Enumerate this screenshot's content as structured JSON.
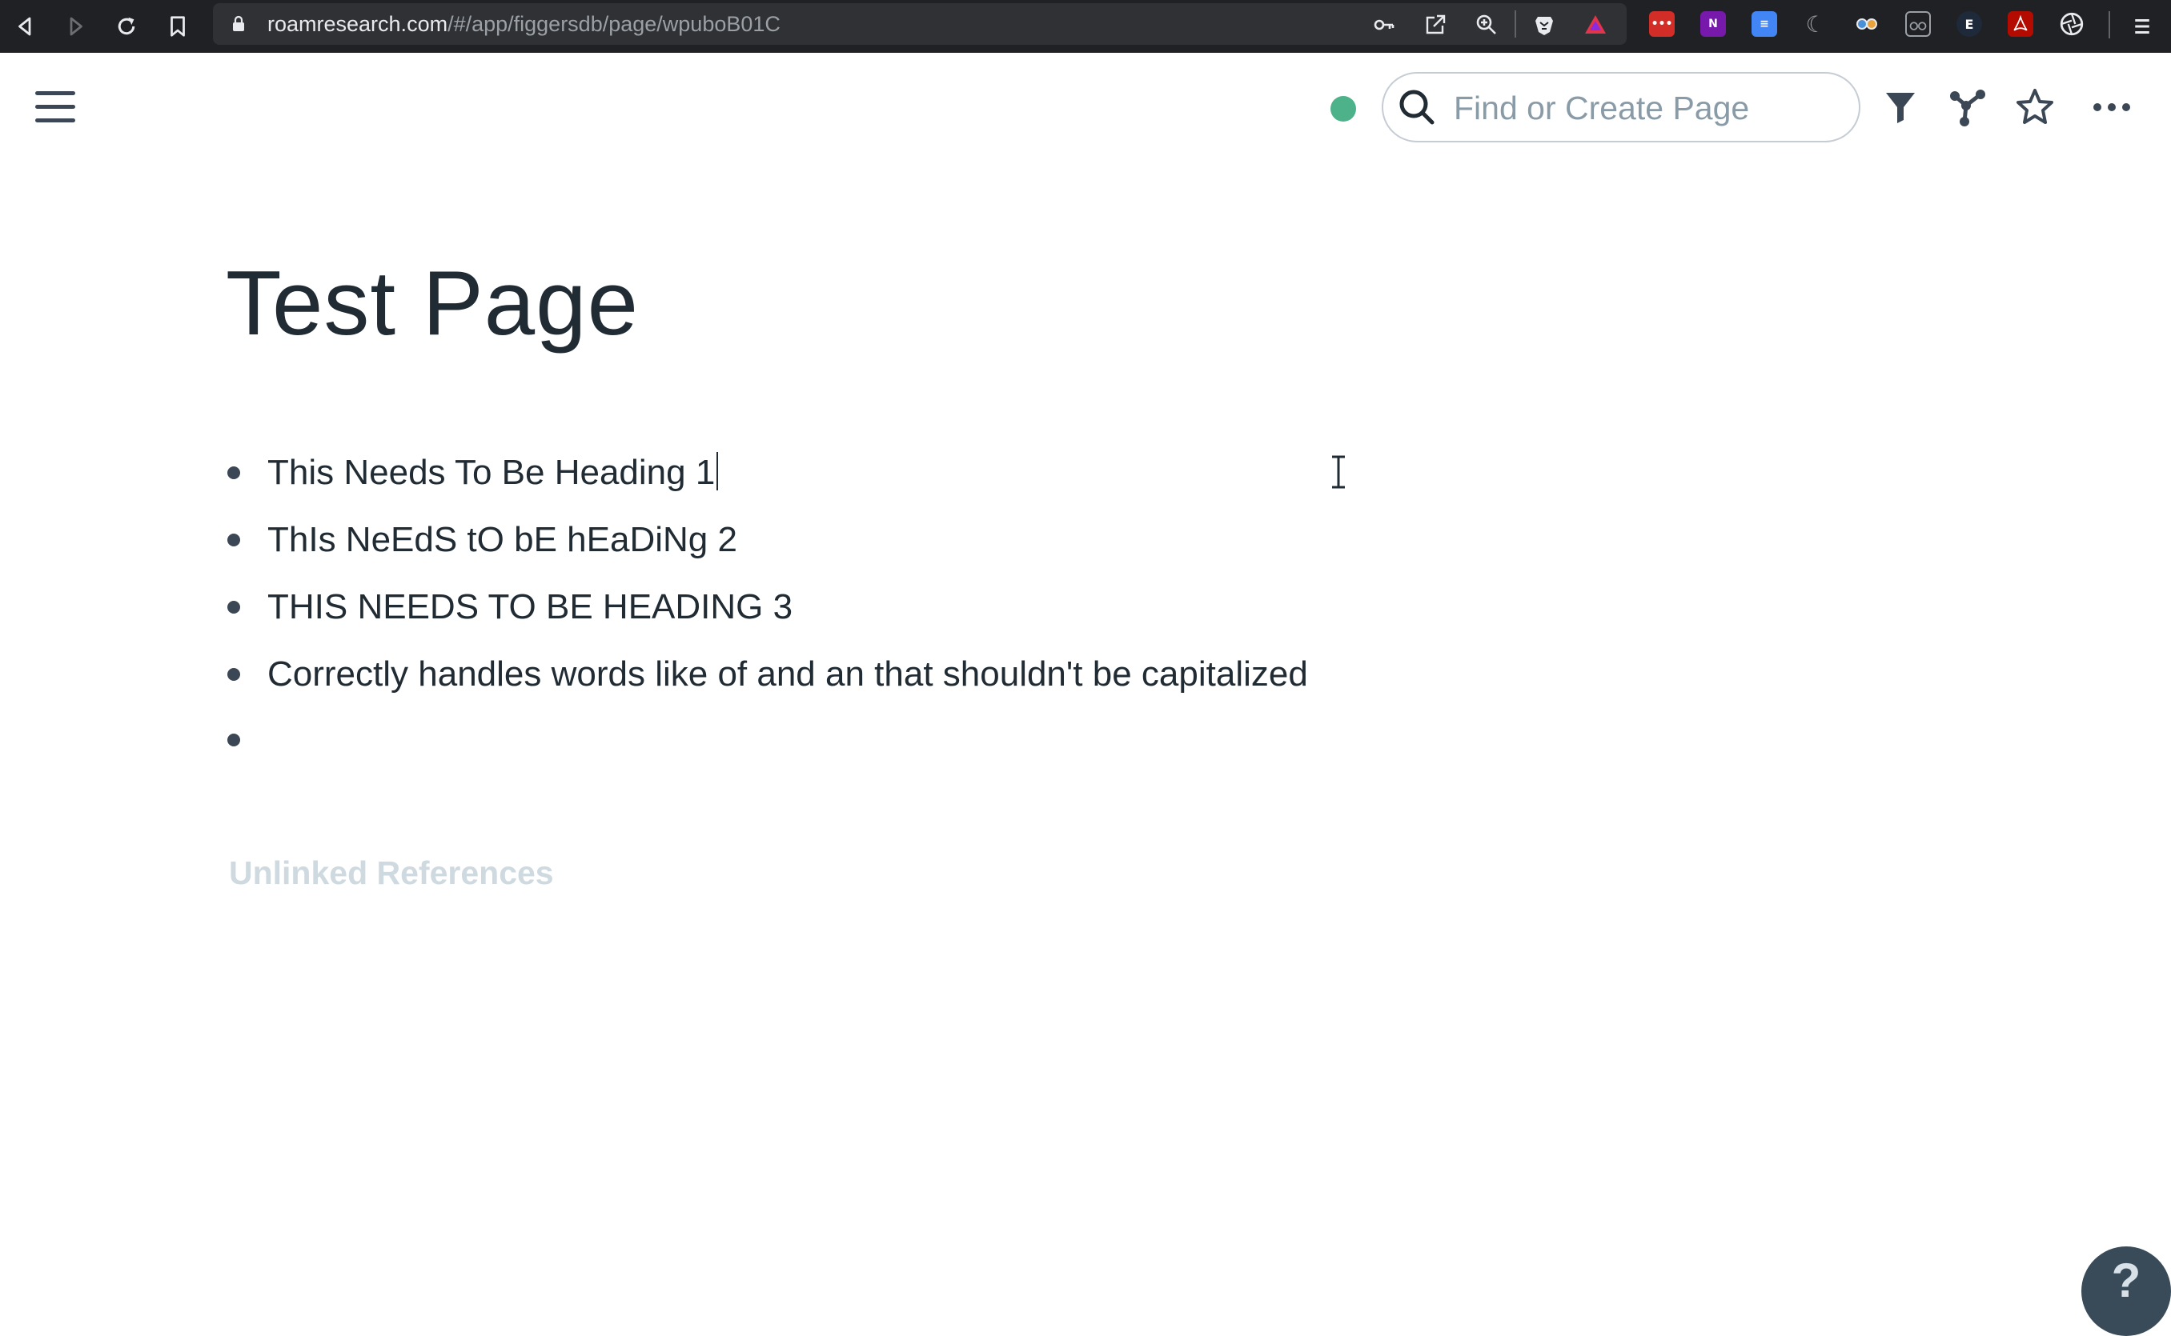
{
  "browser": {
    "url_host": "roamresearch.com",
    "url_path": "/#/app/figgersdb/page/wpuboB01C",
    "extension_icons": [
      "lastpass-icon",
      "onenote-icon",
      "google-docs-icon",
      "extension-icon",
      "extension-icon",
      "reader-icon",
      "evernote-icon",
      "acrobat-icon",
      "extension-icon"
    ]
  },
  "topbar": {
    "status_color": "#4db28a",
    "search_placeholder": "Find or Create Page"
  },
  "page": {
    "title": "Test Page",
    "blocks": [
      {
        "text": "This Needs To Be Heading 1"
      },
      {
        "text": "ThIs NeEdS tO bE hEaDiNg 2"
      },
      {
        "text": "THIS NEEDS TO BE HEADING 3"
      },
      {
        "text": "Correctly handles words like of and an that shouldn't be capitalized"
      },
      {
        "text": ""
      }
    ],
    "unlinked_references_label": "Unlinked References"
  },
  "help": {
    "label": "?"
  }
}
